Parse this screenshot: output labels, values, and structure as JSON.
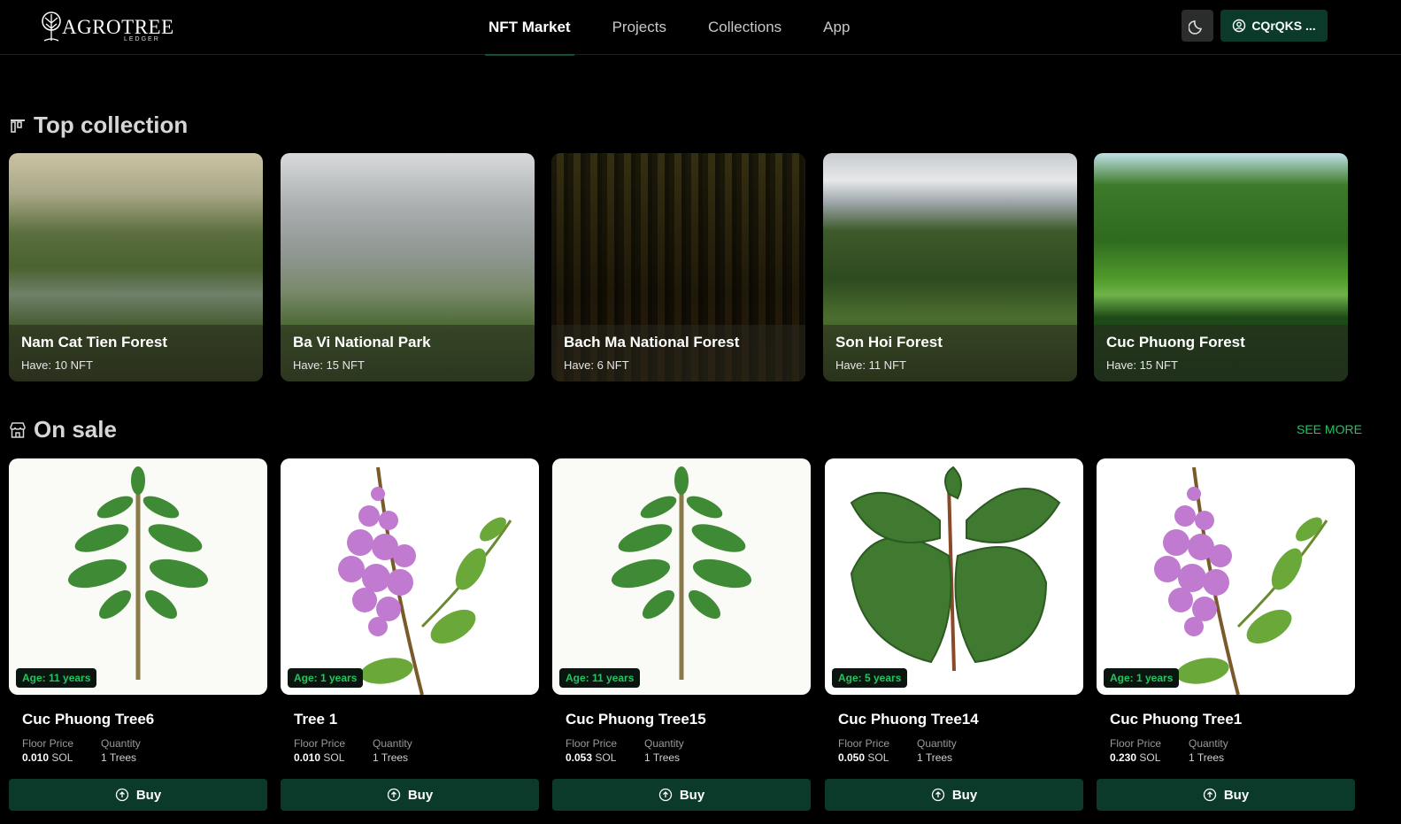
{
  "header": {
    "logo_text": "AGROTREE",
    "logo_sub": "LEDGER",
    "nav": [
      "NFT Market",
      "Projects",
      "Collections",
      "App"
    ],
    "active_nav": "NFT Market",
    "wallet_label": "CQrQKS ..."
  },
  "top_collection": {
    "title": "Top collection",
    "items": [
      {
        "name": "Nam Cat Tien Forest",
        "have": "Have: 10 NFT"
      },
      {
        "name": "Ba Vi National Park",
        "have": "Have: 15 NFT"
      },
      {
        "name": "Bach Ma National Forest",
        "have": "Have: 6 NFT"
      },
      {
        "name": "Son Hoi Forest",
        "have": "Have: 11 NFT"
      },
      {
        "name": "Cuc Phuong Forest",
        "have": "Have: 15 NFT"
      }
    ]
  },
  "on_sale": {
    "title": "On sale",
    "see_more": "SEE MORE",
    "floor_label": "Floor Price",
    "quantity_label": "Quantity",
    "buy_label": "Buy",
    "items": [
      {
        "name": "Cuc Phuong Tree6",
        "age": "Age: 11 years",
        "price": "0.010",
        "unit": "SOL",
        "qty": "1",
        "qty_unit": "Trees"
      },
      {
        "name": "Tree 1",
        "age": "Age: 1 years",
        "price": "0.010",
        "unit": "SOL",
        "qty": "1",
        "qty_unit": "Trees"
      },
      {
        "name": "Cuc Phuong Tree15",
        "age": "Age: 11 years",
        "price": "0.053",
        "unit": "SOL",
        "qty": "1",
        "qty_unit": "Trees"
      },
      {
        "name": "Cuc Phuong Tree14",
        "age": "Age: 5 years",
        "price": "0.050",
        "unit": "SOL",
        "qty": "1",
        "qty_unit": "Trees"
      },
      {
        "name": "Cuc Phuong Tree1",
        "age": "Age: 1 years",
        "price": "0.230",
        "unit": "SOL",
        "qty": "1",
        "qty_unit": "Trees"
      }
    ]
  },
  "colors": {
    "accent": "#22c55e",
    "button_bg": "#0c3a2a",
    "background": "#000000"
  },
  "icons": [
    "tree-logo-icon",
    "moon-icon",
    "user-circle-icon",
    "chart-bars-icon",
    "store-icon",
    "buy-arrow-icon"
  ]
}
